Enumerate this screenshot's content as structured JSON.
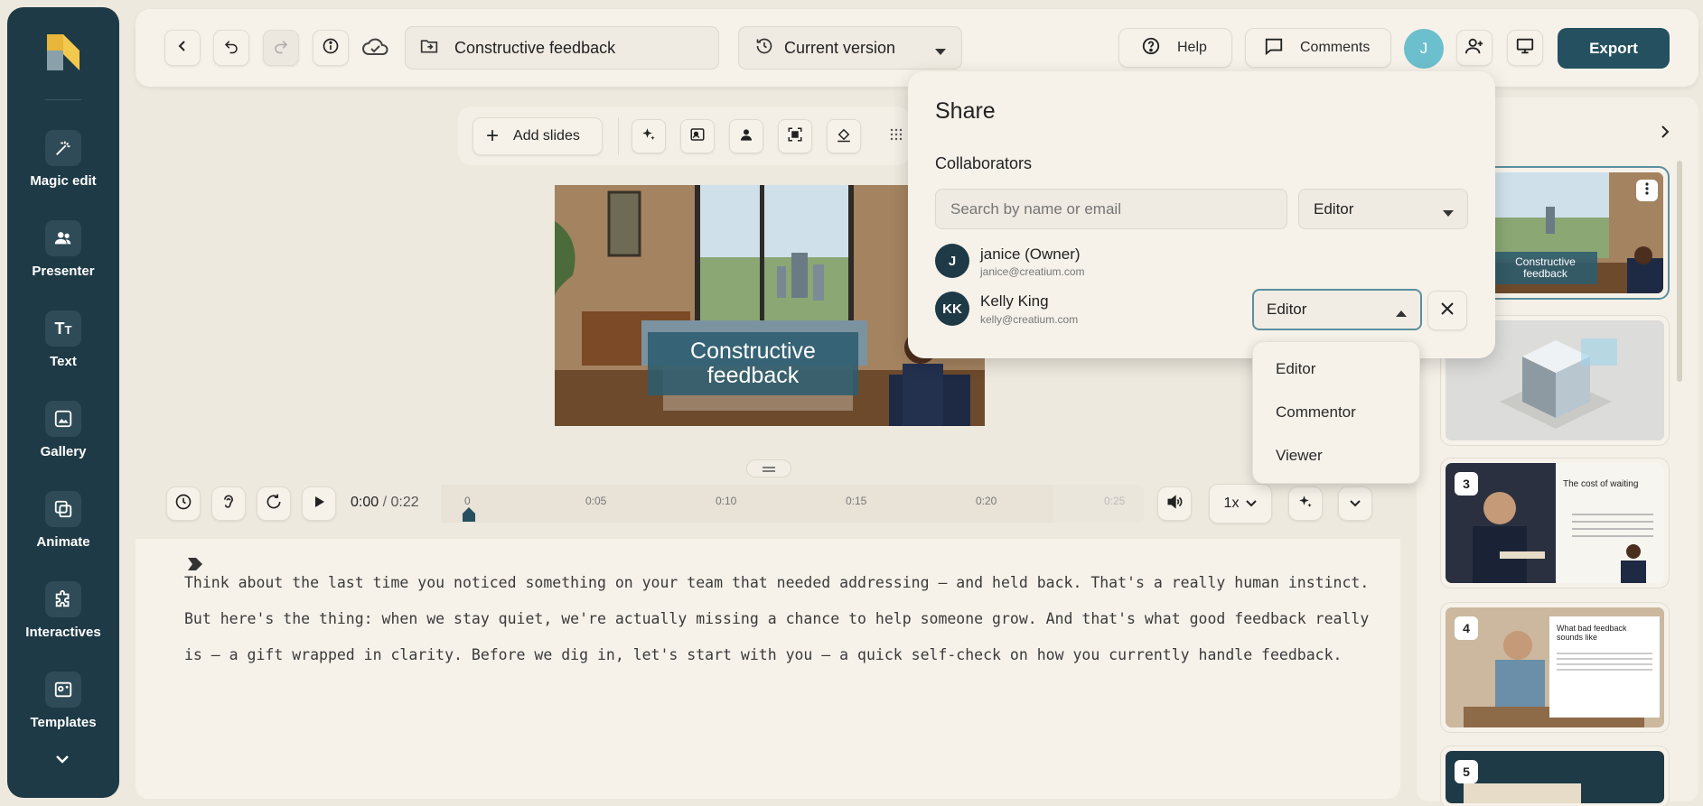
{
  "rail": {
    "items": [
      {
        "label": "Magic edit",
        "icon": "magic-wand-icon"
      },
      {
        "label": "Presenter",
        "icon": "users-icon"
      },
      {
        "label": "Text",
        "icon": "text-icon"
      },
      {
        "label": "Gallery",
        "icon": "image-icon"
      },
      {
        "label": "Animate",
        "icon": "layers-icon"
      },
      {
        "label": "Interactives",
        "icon": "puzzle-icon"
      },
      {
        "label": "Templates",
        "icon": "template-icon"
      }
    ]
  },
  "header": {
    "project_title": "Constructive feedback",
    "version_label": "Current version",
    "help_label": "Help",
    "comments_label": "Comments",
    "user_initial": "J",
    "export_label": "Export"
  },
  "toolbar": {
    "add_slides_label": "Add slides"
  },
  "slide": {
    "title_line1": "Constructive",
    "title_line2": "feedback"
  },
  "timeline": {
    "current_time": "0:00",
    "total_time": "0:22",
    "ticks": [
      "0",
      "0:05",
      "0:10",
      "0:15",
      "0:20",
      "0:25"
    ],
    "speed": "1x"
  },
  "script": {
    "lines": [
      "Think about the last time you noticed something on your team that needed addressing — and held back. That's a really human instinct.",
      "But here's the thing: when we stay quiet, we're actually missing a chance to help someone grow. And that's what good feedback really",
      "is — a gift wrapped in clarity. Before we dig in, let's start with you — a quick self-check on how you currently handle feedback."
    ]
  },
  "thumbnails": [
    {
      "num": "",
      "title_line1": "Constructive",
      "title_line2": "feedback"
    },
    {
      "num": ""
    },
    {
      "num": "3",
      "heading": "The cost of waiting"
    },
    {
      "num": "4",
      "heading": "What bad feedback sounds like"
    },
    {
      "num": "5"
    }
  ],
  "share": {
    "title": "Share",
    "collaborators_label": "Collaborators",
    "search_placeholder": "Search by name or email",
    "role_default": "Editor",
    "collaborators": [
      {
        "initials": "J",
        "name": "janice (Owner)",
        "email": "janice@creatium.com"
      },
      {
        "initials": "KK",
        "name": "Kelly King",
        "email": "kelly@creatium.com",
        "role": "Editor"
      }
    ],
    "role_options": [
      "Editor",
      "Commentor",
      "Viewer"
    ]
  },
  "colors": {
    "rail": "#1e3a46",
    "accent": "#24505f",
    "avatar": "#6cbfcc"
  }
}
